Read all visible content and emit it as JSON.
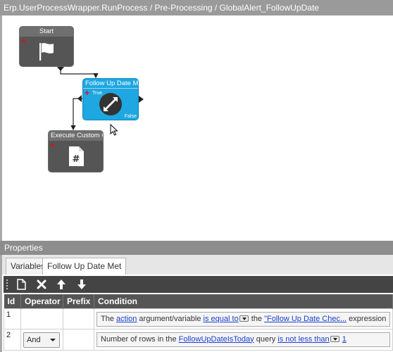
{
  "window": {
    "title": "Erp.UserProcessWrapper.RunProcess / Pre-Processing / GlobalAlert_FollowUpDate"
  },
  "canvas": {
    "nodes": {
      "start": {
        "title": "Start",
        "icon": "flag-icon"
      },
      "condition": {
        "title": "Follow Up Date Met",
        "true_label": "True",
        "false_label": "False",
        "icon": "expand-arrows-icon"
      },
      "execute": {
        "title": "Execute Custom Code",
        "icon": "code-file-icon"
      }
    }
  },
  "properties": {
    "title": "Properties",
    "tabs": [
      {
        "label": "Variables",
        "active": false
      },
      {
        "label": "Follow Up Date Met",
        "active": true
      }
    ],
    "toolbar": {
      "buttons": [
        "new-icon",
        "delete-icon",
        "move-up-icon",
        "move-down-icon"
      ]
    },
    "grid": {
      "columns": [
        "Id",
        "Operator",
        "Prefix",
        "Condition"
      ],
      "rows": [
        {
          "id": "1",
          "operator": "",
          "prefix": "",
          "condition": {
            "t1": "The ",
            "link1": "action",
            "t2": " argument/variable ",
            "link2": "is equal to",
            "t3": " the ",
            "link3": "\"Follow Up Date Chec...",
            "t4": " expression"
          }
        },
        {
          "id": "2",
          "operator": "And",
          "prefix": "",
          "condition": {
            "t1": "Number of rows in the ",
            "link1": "FollowUpDateIsToday",
            "t2": " query ",
            "link2": "is not less than",
            "t3": " ",
            "link3": "1"
          }
        }
      ]
    }
  },
  "colors": {
    "accent": "#1ea7e1",
    "node_dark": "#555555",
    "link": "#1a3fd0"
  }
}
